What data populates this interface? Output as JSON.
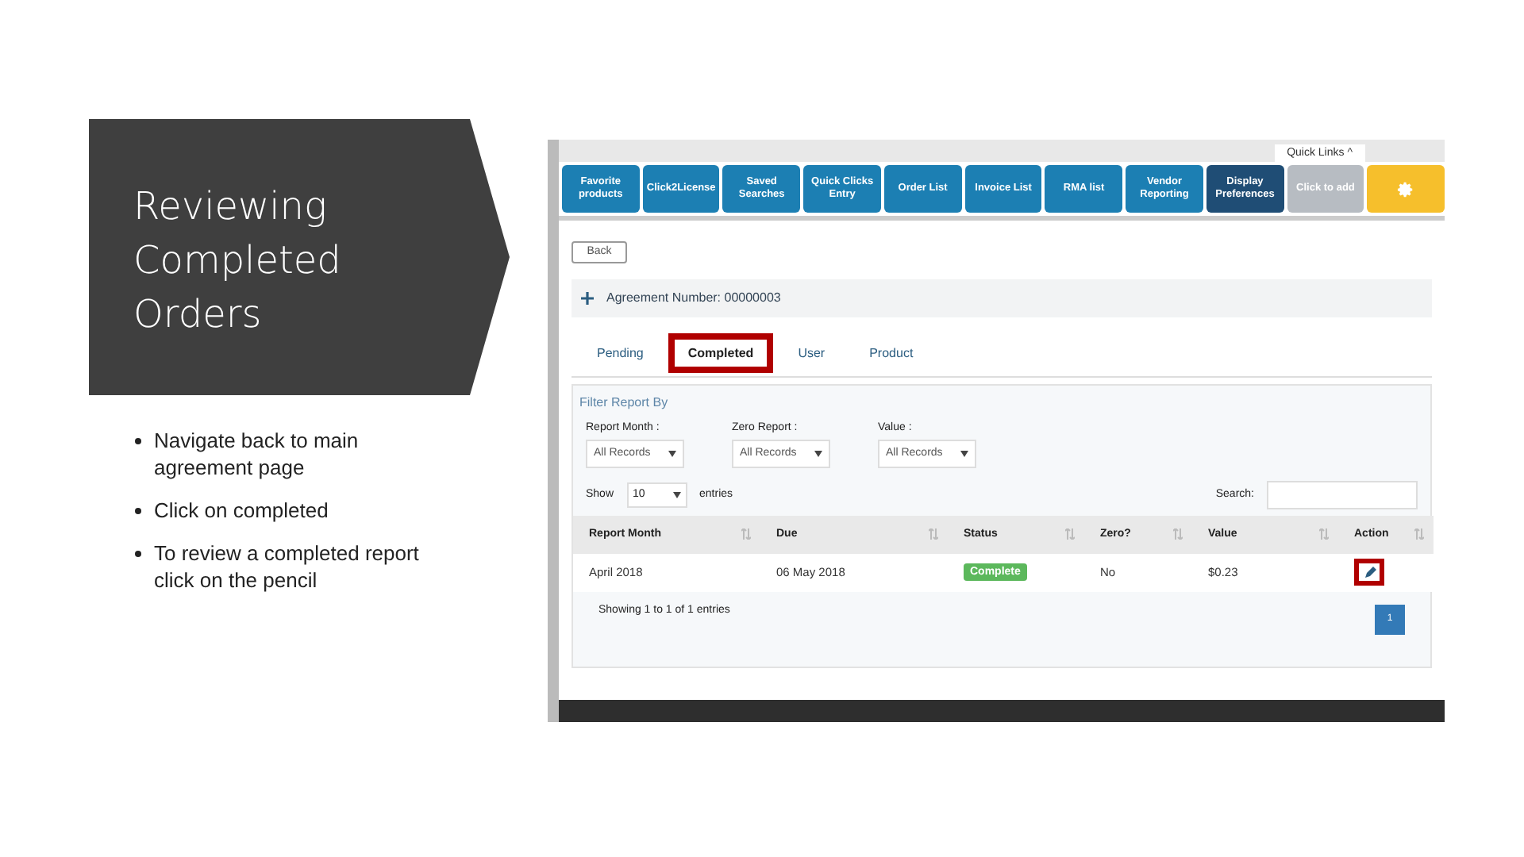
{
  "slide": {
    "title": "Reviewing Completed Orders",
    "bullets": [
      "Navigate back to main agreement page",
      "Click on completed",
      "To review a completed report click on the pencil"
    ]
  },
  "screenshot": {
    "quick_links_tab": "Quick Links ^",
    "quick_links": [
      {
        "kind": "normal",
        "label": "Favorite products"
      },
      {
        "kind": "normal",
        "label": "Click2License"
      },
      {
        "kind": "normal",
        "label": "Saved Searches"
      },
      {
        "kind": "normal",
        "label": "Quick Clicks Entry"
      },
      {
        "kind": "normal",
        "label": "Order List"
      },
      {
        "kind": "normal",
        "label": "Invoice List"
      },
      {
        "kind": "normal",
        "label": "RMA list"
      },
      {
        "kind": "normal",
        "label": "Vendor Reporting"
      },
      {
        "kind": "dark",
        "label": "Display Preferences"
      },
      {
        "kind": "add",
        "label": "Click to add"
      },
      {
        "kind": "settings"
      }
    ],
    "back_button": "Back",
    "agreement": "Agreement Number: 00000003",
    "tabs": [
      {
        "label": "Pending",
        "selected": false,
        "highlighted": false
      },
      {
        "label": "Completed",
        "selected": true,
        "highlighted": true
      },
      {
        "label": "User",
        "selected": false,
        "highlighted": false
      },
      {
        "label": "Product",
        "selected": false,
        "highlighted": false
      }
    ],
    "filter_title": "Filter Report By",
    "filters": [
      {
        "label": "Report Month :",
        "value": "All Records"
      },
      {
        "label": "Zero Report :",
        "value": "All Records"
      },
      {
        "label": "Value :",
        "value": "All Records"
      }
    ],
    "show_label": "Show",
    "show_value": "10",
    "entries_label": "entries",
    "search_label": "Search:",
    "columns": [
      "Report Month",
      "Due",
      "Status",
      "Zero?",
      "Value",
      "Action"
    ],
    "rows": [
      {
        "report_month": "April 2018",
        "due": "06 May 2018",
        "status": "Complete",
        "zero": "No",
        "value": "$0.23",
        "action_highlighted": true
      }
    ],
    "info": "Showing 1 to 1 of 1 entries",
    "pages": [
      {
        "label": "1",
        "selected": true
      }
    ]
  }
}
